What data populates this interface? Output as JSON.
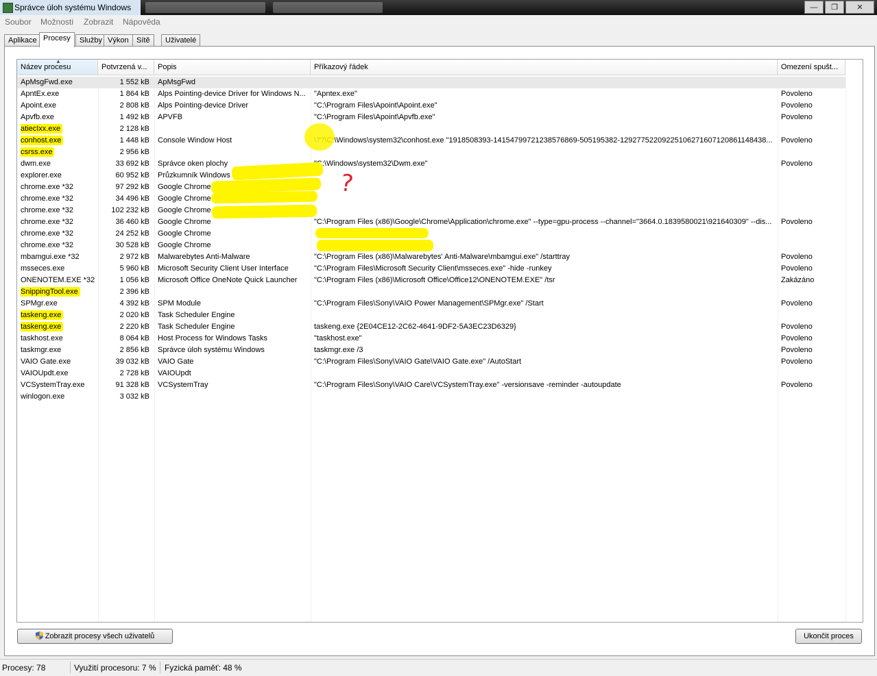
{
  "window": {
    "title": "Správce úloh systému Windows"
  },
  "menu": [
    "Soubor",
    "Možnosti",
    "Zobrazit",
    "Nápověda"
  ],
  "tabs": [
    "Aplikace",
    "Procesy",
    "Služby",
    "Výkon",
    "Sítě",
    "Uživatelé"
  ],
  "active_tab": "Procesy",
  "columns": [
    "Název procesu",
    "Potvrzená v...",
    "Popis",
    "Příkazový řádek",
    "Omezení spušt..."
  ],
  "processes": [
    {
      "name": "ApMsgFwd.exe",
      "mem": "1 552 kB",
      "desc": "ApMsgFwd",
      "cmd": "",
      "virt": "",
      "hl": false
    },
    {
      "name": "ApntEx.exe",
      "mem": "1 864 kB",
      "desc": "Alps Pointing-device Driver for Windows N...",
      "cmd": "\"Apntex.exe\"",
      "virt": "Povoleno",
      "hl": false
    },
    {
      "name": "Apoint.exe",
      "mem": "2 808 kB",
      "desc": "Alps Pointing-device Driver",
      "cmd": "\"C:\\Program Files\\Apoint\\Apoint.exe\"",
      "virt": "Povoleno",
      "hl": false
    },
    {
      "name": "Apvfb.exe",
      "mem": "1 492 kB",
      "desc": "APVFB",
      "cmd": "\"C:\\Program Files\\Apoint\\Apvfb.exe\"",
      "virt": "Povoleno",
      "hl": false
    },
    {
      "name": "atiecIxx.exe",
      "mem": "2 128 kB",
      "desc": "",
      "cmd": "",
      "virt": "",
      "hl": true
    },
    {
      "name": "conhost.exe",
      "mem": "1 448 kB",
      "desc": "Console Window Host",
      "cmd": "\\??\\C:\\Windows\\system32\\conhost.exe \"1918508393-14154799721238576869-505195382-12927752209225106271607120861148438...",
      "virt": "Povoleno",
      "hl": true
    },
    {
      "name": "csrss.exe",
      "mem": "2 956 kB",
      "desc": "",
      "cmd": "",
      "virt": "",
      "hl": true
    },
    {
      "name": "dwm.exe",
      "mem": "33 692 kB",
      "desc": "Správce oken plochy",
      "cmd": "\"C:\\Windows\\system32\\Dwm.exe\"",
      "virt": "Povoleno",
      "hl": false
    },
    {
      "name": "explorer.exe",
      "mem": "60 952 kB",
      "desc": "Průzkumník Windows",
      "cmd": "",
      "virt": "",
      "hl": false
    },
    {
      "name": "chrome.exe *32",
      "mem": "97 292 kB",
      "desc": "Google Chrome",
      "cmd": "",
      "virt": "",
      "hl": false
    },
    {
      "name": "chrome.exe *32",
      "mem": "34 496 kB",
      "desc": "Google Chrome",
      "cmd": "",
      "virt": "",
      "hl": false
    },
    {
      "name": "chrome.exe *32",
      "mem": "102 232 kB",
      "desc": "Google Chrome",
      "cmd": "",
      "virt": "",
      "hl": false
    },
    {
      "name": "chrome.exe *32",
      "mem": "36 460 kB",
      "desc": "Google Chrome",
      "cmd": "\"C:\\Program Files (x86)\\Google\\Chrome\\Application\\chrome.exe\" --type=gpu-process --channel=\"3664.0.1839580021\\921640309\" --dis...",
      "virt": "Povoleno",
      "hl": false
    },
    {
      "name": "chrome.exe *32",
      "mem": "24 252 kB",
      "desc": "Google Chrome",
      "cmd": "",
      "virt": "",
      "hl": false
    },
    {
      "name": "chrome.exe *32",
      "mem": "30 528 kB",
      "desc": "Google Chrome",
      "cmd": "",
      "virt": "",
      "hl": false
    },
    {
      "name": "mbamgui.exe *32",
      "mem": "2 972 kB",
      "desc": "Malwarebytes Anti-Malware",
      "cmd": "\"C:\\Program Files (x86)\\Malwarebytes' Anti-Malware\\mbamgui.exe\" /starttray",
      "virt": "Povoleno",
      "hl": false
    },
    {
      "name": "msseces.exe",
      "mem": "5 960 kB",
      "desc": "Microsoft Security Client User Interface",
      "cmd": "\"C:\\Program Files\\Microsoft Security Client\\msseces.exe\" -hide -runkey",
      "virt": "Povoleno",
      "hl": false
    },
    {
      "name": "ONENOTEM.EXE *32",
      "mem": "1 056 kB",
      "desc": "Microsoft Office OneNote Quick Launcher",
      "cmd": "\"C:\\Program Files (x86)\\Microsoft Office\\Office12\\ONENOTEM.EXE\" /tsr",
      "virt": "Zakázáno",
      "hl": false
    },
    {
      "name": "SnippingTool.exe",
      "mem": "2 396 kB",
      "desc": "",
      "cmd": "",
      "virt": "",
      "hl": true
    },
    {
      "name": "SPMgr.exe",
      "mem": "4 392 kB",
      "desc": "SPM Module",
      "cmd": "\"C:\\Program Files\\Sony\\VAIO Power Management\\SPMgr.exe\" /Start",
      "virt": "Povoleno",
      "hl": false
    },
    {
      "name": "taskeng.exe",
      "mem": "2 020 kB",
      "desc": "Task Scheduler Engine",
      "cmd": "",
      "virt": "",
      "hl": true
    },
    {
      "name": "taskeng.exe",
      "mem": "2 220 kB",
      "desc": "Task Scheduler Engine",
      "cmd": "taskeng.exe {2E04CE12-2C62-4641-9DF2-5A3EC23D6329}",
      "virt": "Povoleno",
      "hl": true
    },
    {
      "name": "taskhost.exe",
      "mem": "8 064 kB",
      "desc": "Host Process for Windows Tasks",
      "cmd": "\"taskhost.exe\"",
      "virt": "Povoleno",
      "hl": false
    },
    {
      "name": "taskmgr.exe",
      "mem": "2 856 kB",
      "desc": "Správce úloh systému Windows",
      "cmd": "taskmgr.exe /3",
      "virt": "Povoleno",
      "hl": false
    },
    {
      "name": "VAIO Gate.exe",
      "mem": "39 032 kB",
      "desc": "VAIO Gate",
      "cmd": "\"C:\\Program Files\\Sony\\VAIO Gate\\VAIO Gate.exe\" /AutoStart",
      "virt": "Povoleno",
      "hl": false
    },
    {
      "name": "VAIOUpdt.exe",
      "mem": "2 728 kB",
      "desc": "VAIOUpdt",
      "cmd": "",
      "virt": "",
      "hl": false
    },
    {
      "name": "VCSystemTray.exe",
      "mem": "91 328 kB",
      "desc": "VCSystemTray",
      "cmd": "\"C:\\Program Files\\Sony\\VAIO Care\\VCSystemTray.exe\" -versionsave -reminder -autoupdate",
      "virt": "Povoleno",
      "hl": false
    },
    {
      "name": "winlogon.exe",
      "mem": "3 032 kB",
      "desc": "",
      "cmd": "",
      "virt": "",
      "hl": false
    }
  ],
  "buttons": {
    "show_all": "Zobrazit procesy všech uživatelů",
    "end_process": "Ukončit proces"
  },
  "status": {
    "processes": "Procesy: 78",
    "cpu": "Využití procesoru: 7 %",
    "memory": "Fyzická paměť: 48 %"
  },
  "annotation": {
    "mark": "?"
  },
  "colors": {
    "highlight": "#fff500",
    "annotation_ink": "#e0202a"
  }
}
